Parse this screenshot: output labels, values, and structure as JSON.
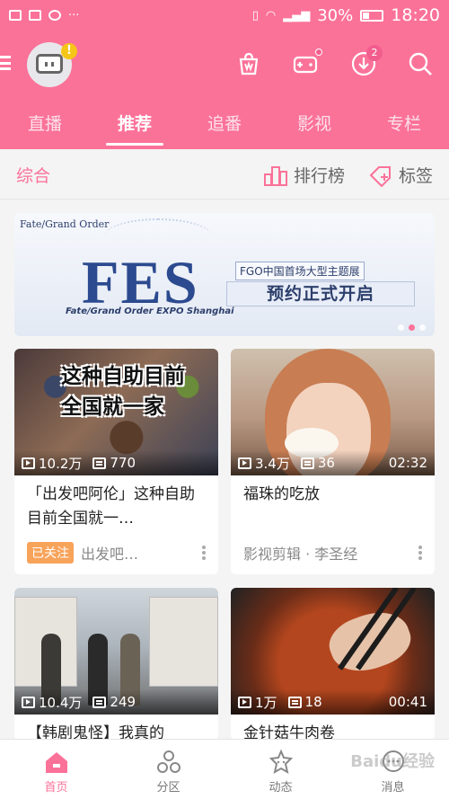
{
  "status_bar": {
    "battery": "30%",
    "time": "18:20",
    "dots": "···"
  },
  "header": {
    "avatar_badge": "!",
    "download_count": "2",
    "colors": {
      "accent": "#fb7299",
      "badge": "#f25d8e"
    }
  },
  "tabs": [
    {
      "label": "直播"
    },
    {
      "label": "推荐",
      "active": true
    },
    {
      "label": "追番"
    },
    {
      "label": "影视"
    },
    {
      "label": "专栏"
    }
  ],
  "subbar": {
    "title": "综合",
    "ranking_label": "排行榜",
    "tags_label": "标签"
  },
  "banner": {
    "brand": "Fate/Grand Order",
    "headline": "FES",
    "subtitle": "Fate/Grand Order EXPO Shanghai",
    "small_text": "FGO中国首场大型主题展",
    "main_text": "预约正式开启"
  },
  "cards": [
    {
      "overlay": "这种自助目前\n全国就一家",
      "plays": "10.2万",
      "danmaku": "770",
      "duration": "",
      "title": "「出发吧阿伦」这种自助目前全国就一…",
      "follow": "已关注",
      "author": "出发吧…"
    },
    {
      "overlay": "",
      "plays": "3.4万",
      "danmaku": "36",
      "duration": "02:32",
      "title": "福珠的吃放",
      "follow": "",
      "author": "影视剪辑 · 李圣经"
    },
    {
      "overlay": "",
      "plays": "10.4万",
      "danmaku": "249",
      "duration": "",
      "title": "【韩剧鬼怪】我真的",
      "follow": "",
      "author": ""
    },
    {
      "overlay": "",
      "plays": "1万",
      "danmaku": "18",
      "duration": "00:41",
      "title": "金针菇牛肉卷",
      "follow": "",
      "author": ""
    }
  ],
  "bottom_nav": [
    {
      "label": "首页",
      "active": true,
      "icon": "home-icon"
    },
    {
      "label": "分区",
      "icon": "category-icon"
    },
    {
      "label": "动态",
      "icon": "dynamic-icon"
    },
    {
      "label": "消息",
      "icon": "message-icon"
    }
  ],
  "watermark": "Baidu经验"
}
